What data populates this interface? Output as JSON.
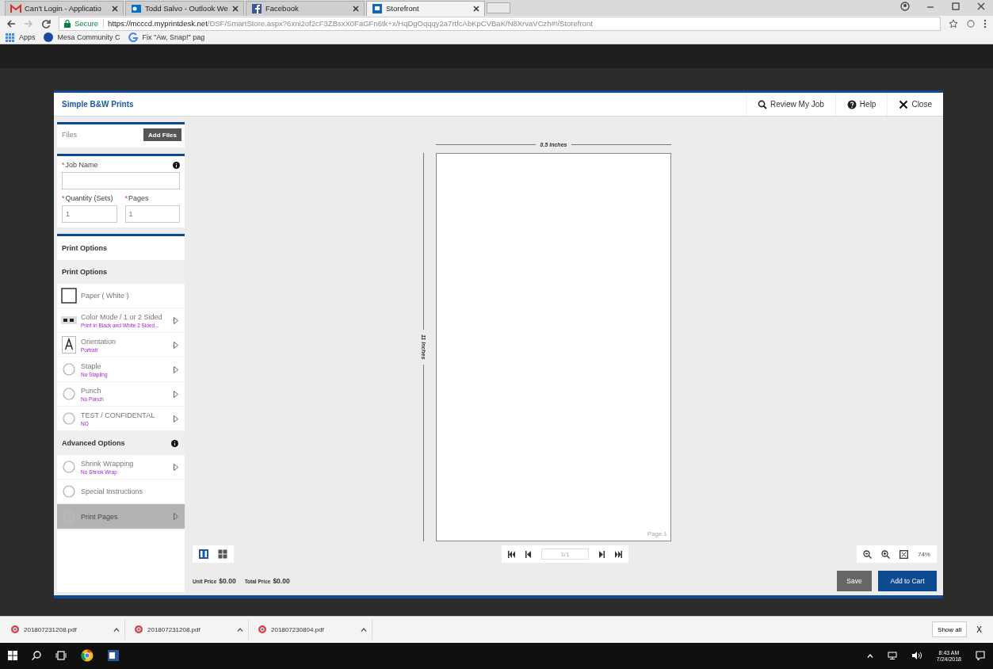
{
  "browser": {
    "tabs": [
      {
        "label": "Can't Login - Applicatio",
        "selected": false
      },
      {
        "label": "Todd Salvo - Outlook We",
        "selected": false
      },
      {
        "label": "Facebook",
        "selected": false
      },
      {
        "label": "Storefront",
        "selected": true
      }
    ],
    "address": {
      "secure": "Secure",
      "host": "https://mcccd.myprintdesk.net",
      "path": "/DSF/SmartStore.aspx?6xni2of2cF3ZBsxX0FaGFn6tk+x/HqDgOqqqy2a7rtfcAbKpCVBaK/N8XrvaVCzh#!/Storefront"
    },
    "bookmarks": [
      {
        "label": "Apps"
      },
      {
        "label": "Mesa Community C"
      },
      {
        "label": "Fix \"Aw, Snap!\" pag"
      }
    ]
  },
  "modal": {
    "title": "Simple B&W Prints",
    "actions": [
      {
        "label": "Review My Job"
      },
      {
        "label": "Help"
      },
      {
        "label": "Close"
      }
    ],
    "files": {
      "label": "Files",
      "button": "Add Files"
    },
    "job": {
      "required_mark": "*",
      "name_label": "Job Name",
      "quantity_label": "Quantity (Sets)",
      "quantity_value": "1",
      "pages_label": "Pages",
      "pages_value": "1"
    },
    "print_options": {
      "title": "Print Options",
      "section_title": "Print Options",
      "items": [
        {
          "kind": "paper",
          "label": "Paper ( White )",
          "arrow": false
        },
        {
          "kind": "duplex",
          "label": "Color Mode / 1 or 2 Sided",
          "value": "Print In Black and White 2 Sided...",
          "arrow": true
        },
        {
          "kind": "letter",
          "label": "Orientation",
          "value": "Portrait",
          "arrow": true
        },
        {
          "kind": "radio",
          "label": "Staple",
          "value": "No Stapling",
          "arrow": true
        },
        {
          "kind": "radio",
          "label": "Punch",
          "value": "No Punch",
          "arrow": true
        },
        {
          "kind": "radio",
          "label": "TEST / CONFIDENTAL",
          "value": "NO",
          "arrow": true
        }
      ]
    },
    "advanced": {
      "title": "Advanced Options",
      "items": [
        {
          "kind": "radio",
          "label": "Shrink Wrapping",
          "value": "No Shrink Wrap",
          "arrow": true,
          "disabled": false
        },
        {
          "kind": "radio",
          "label": "Special Instructions",
          "arrow": false,
          "disabled": false
        },
        {
          "kind": "radio",
          "label": "Print Pages",
          "arrow": true,
          "disabled": true
        }
      ]
    },
    "preview": {
      "width_label": "8.5 Inches",
      "height_label": "11 Inches",
      "page_label": "Page 1",
      "page_indicator": "1/1",
      "zoom": "74%",
      "view_modes": [
        {
          "kind": "single",
          "selected": true
        },
        {
          "kind": "grid",
          "selected": false
        }
      ]
    },
    "footer": {
      "unit_price_label": "Unit Price",
      "unit_price": "$0.00",
      "total_price_label": "Total Price",
      "total_price": "$0.00",
      "save": "Save",
      "add_to_cart": "Add to Cart"
    }
  },
  "downloads": {
    "files": [
      "201807231208.pdf",
      "201807231208.pdf",
      "201807230804.pdf"
    ],
    "show_all": "Show all",
    "close": "X"
  },
  "taskbar": {
    "time": "8:43 AM",
    "date": "7/24/2018"
  }
}
